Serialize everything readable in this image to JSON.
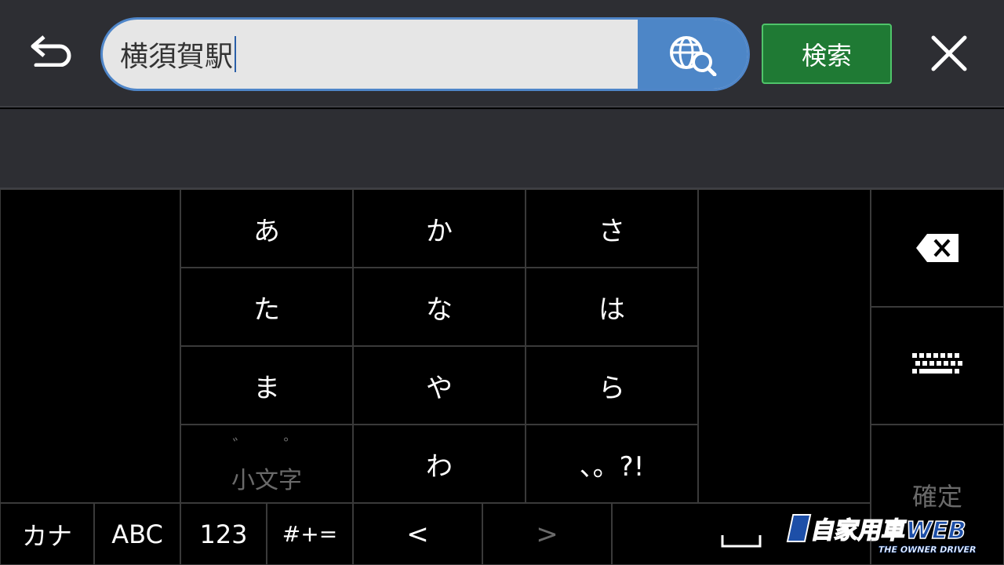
{
  "header": {
    "back_icon": "undo-arrow-icon",
    "search_value": "横須賀駅",
    "web_search_icon": "globe-search-icon",
    "search_button_label": "検索",
    "close_icon": "close-icon"
  },
  "keypad": {
    "rows": [
      [
        "あ",
        "か",
        "さ"
      ],
      [
        "た",
        "な",
        "は"
      ],
      [
        "ま",
        "や",
        "ら"
      ]
    ],
    "small_key": {
      "marks": "゛ ゜",
      "label": "小文字"
    },
    "wa_key": "わ",
    "punct_key": "、。?!"
  },
  "side": {
    "backspace_icon": "backspace-icon",
    "keyboard_icon": "keyboard-icon",
    "confirm_label": "確定"
  },
  "bottom_row": {
    "kana": "カナ",
    "abc": "ABC",
    "num": "123",
    "sym": "#+=",
    "left_arrow": "<",
    "right_arrow": ">",
    "space_symbol": "␣"
  },
  "watermark": {
    "title": "月刊自家用車WEB",
    "subtitle": "THE OWNER DRIVER"
  },
  "colors": {
    "search_accent": "#4d86c7",
    "search_button": "#1f7a34",
    "bar_background": "#2d2e33"
  }
}
